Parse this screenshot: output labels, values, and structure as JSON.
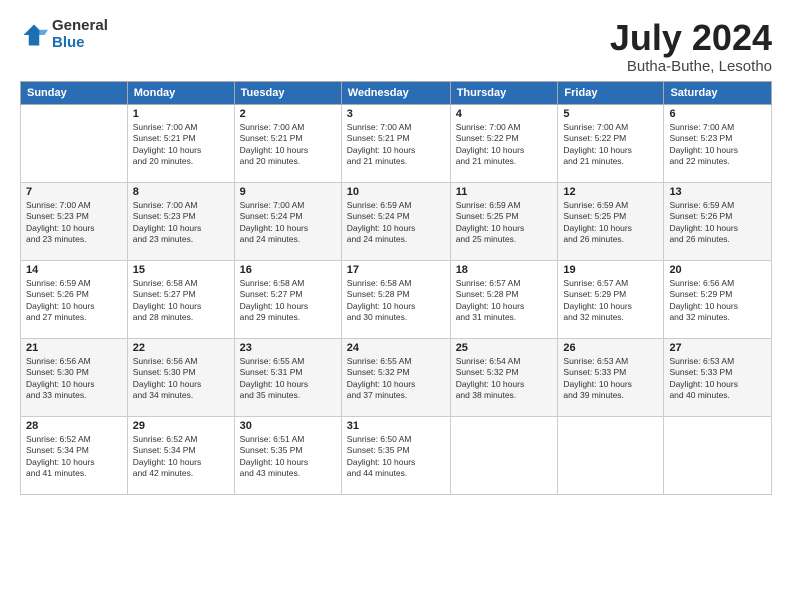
{
  "logo": {
    "general": "General",
    "blue": "Blue"
  },
  "title": "July 2024",
  "location": "Butha-Buthe, Lesotho",
  "days_of_week": [
    "Sunday",
    "Monday",
    "Tuesday",
    "Wednesday",
    "Thursday",
    "Friday",
    "Saturday"
  ],
  "weeks": [
    [
      {
        "day": "",
        "info": ""
      },
      {
        "day": "1",
        "info": "Sunrise: 7:00 AM\nSunset: 5:21 PM\nDaylight: 10 hours\nand 20 minutes."
      },
      {
        "day": "2",
        "info": "Sunrise: 7:00 AM\nSunset: 5:21 PM\nDaylight: 10 hours\nand 20 minutes."
      },
      {
        "day": "3",
        "info": "Sunrise: 7:00 AM\nSunset: 5:21 PM\nDaylight: 10 hours\nand 21 minutes."
      },
      {
        "day": "4",
        "info": "Sunrise: 7:00 AM\nSunset: 5:22 PM\nDaylight: 10 hours\nand 21 minutes."
      },
      {
        "day": "5",
        "info": "Sunrise: 7:00 AM\nSunset: 5:22 PM\nDaylight: 10 hours\nand 21 minutes."
      },
      {
        "day": "6",
        "info": "Sunrise: 7:00 AM\nSunset: 5:23 PM\nDaylight: 10 hours\nand 22 minutes."
      }
    ],
    [
      {
        "day": "7",
        "info": "Sunrise: 7:00 AM\nSunset: 5:23 PM\nDaylight: 10 hours\nand 23 minutes."
      },
      {
        "day": "8",
        "info": "Sunrise: 7:00 AM\nSunset: 5:23 PM\nDaylight: 10 hours\nand 23 minutes."
      },
      {
        "day": "9",
        "info": "Sunrise: 7:00 AM\nSunset: 5:24 PM\nDaylight: 10 hours\nand 24 minutes."
      },
      {
        "day": "10",
        "info": "Sunrise: 6:59 AM\nSunset: 5:24 PM\nDaylight: 10 hours\nand 24 minutes."
      },
      {
        "day": "11",
        "info": "Sunrise: 6:59 AM\nSunset: 5:25 PM\nDaylight: 10 hours\nand 25 minutes."
      },
      {
        "day": "12",
        "info": "Sunrise: 6:59 AM\nSunset: 5:25 PM\nDaylight: 10 hours\nand 26 minutes."
      },
      {
        "day": "13",
        "info": "Sunrise: 6:59 AM\nSunset: 5:26 PM\nDaylight: 10 hours\nand 26 minutes."
      }
    ],
    [
      {
        "day": "14",
        "info": "Sunrise: 6:59 AM\nSunset: 5:26 PM\nDaylight: 10 hours\nand 27 minutes."
      },
      {
        "day": "15",
        "info": "Sunrise: 6:58 AM\nSunset: 5:27 PM\nDaylight: 10 hours\nand 28 minutes."
      },
      {
        "day": "16",
        "info": "Sunrise: 6:58 AM\nSunset: 5:27 PM\nDaylight: 10 hours\nand 29 minutes."
      },
      {
        "day": "17",
        "info": "Sunrise: 6:58 AM\nSunset: 5:28 PM\nDaylight: 10 hours\nand 30 minutes."
      },
      {
        "day": "18",
        "info": "Sunrise: 6:57 AM\nSunset: 5:28 PM\nDaylight: 10 hours\nand 31 minutes."
      },
      {
        "day": "19",
        "info": "Sunrise: 6:57 AM\nSunset: 5:29 PM\nDaylight: 10 hours\nand 32 minutes."
      },
      {
        "day": "20",
        "info": "Sunrise: 6:56 AM\nSunset: 5:29 PM\nDaylight: 10 hours\nand 32 minutes."
      }
    ],
    [
      {
        "day": "21",
        "info": "Sunrise: 6:56 AM\nSunset: 5:30 PM\nDaylight: 10 hours\nand 33 minutes."
      },
      {
        "day": "22",
        "info": "Sunrise: 6:56 AM\nSunset: 5:30 PM\nDaylight: 10 hours\nand 34 minutes."
      },
      {
        "day": "23",
        "info": "Sunrise: 6:55 AM\nSunset: 5:31 PM\nDaylight: 10 hours\nand 35 minutes."
      },
      {
        "day": "24",
        "info": "Sunrise: 6:55 AM\nSunset: 5:32 PM\nDaylight: 10 hours\nand 37 minutes."
      },
      {
        "day": "25",
        "info": "Sunrise: 6:54 AM\nSunset: 5:32 PM\nDaylight: 10 hours\nand 38 minutes."
      },
      {
        "day": "26",
        "info": "Sunrise: 6:53 AM\nSunset: 5:33 PM\nDaylight: 10 hours\nand 39 minutes."
      },
      {
        "day": "27",
        "info": "Sunrise: 6:53 AM\nSunset: 5:33 PM\nDaylight: 10 hours\nand 40 minutes."
      }
    ],
    [
      {
        "day": "28",
        "info": "Sunrise: 6:52 AM\nSunset: 5:34 PM\nDaylight: 10 hours\nand 41 minutes."
      },
      {
        "day": "29",
        "info": "Sunrise: 6:52 AM\nSunset: 5:34 PM\nDaylight: 10 hours\nand 42 minutes."
      },
      {
        "day": "30",
        "info": "Sunrise: 6:51 AM\nSunset: 5:35 PM\nDaylight: 10 hours\nand 43 minutes."
      },
      {
        "day": "31",
        "info": "Sunrise: 6:50 AM\nSunset: 5:35 PM\nDaylight: 10 hours\nand 44 minutes."
      },
      {
        "day": "",
        "info": ""
      },
      {
        "day": "",
        "info": ""
      },
      {
        "day": "",
        "info": ""
      }
    ]
  ]
}
